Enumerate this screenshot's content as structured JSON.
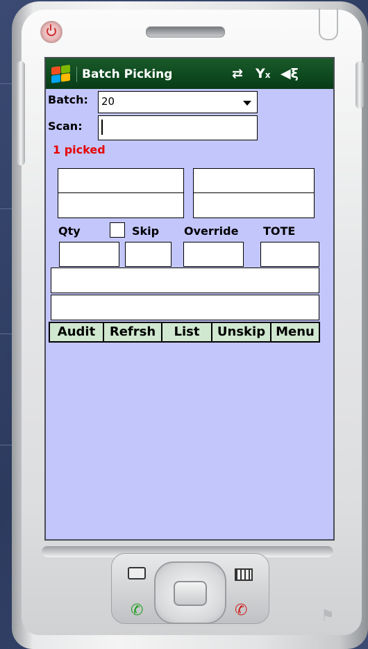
{
  "title": "Batch Picking",
  "icons": {
    "start": "windows-flag-icon",
    "connectivity": "sync-arrows-icon",
    "signal": "no-signal-icon",
    "volume": "speaker-mute-icon",
    "power": "power-icon",
    "contacts": "contact-card-icon",
    "calendar": "calendar-icon",
    "call": "green-phone-icon",
    "end": "red-phone-icon"
  },
  "form": {
    "batch_label": "Batch:",
    "batch_value": "20",
    "scan_label": "Scan:",
    "scan_value": "",
    "status": "1 picked",
    "qty_label": "Qty",
    "skip_label": "Skip",
    "override_label": "Override",
    "tote_label": "TOTE"
  },
  "toolbar": [
    "Audit",
    "Refrsh",
    "List",
    "Unskip",
    "Menu"
  ],
  "colors": {
    "screen_bg": "#c3c6fb",
    "titlebar": "#0e4a1f",
    "status_text": "#e60000",
    "button_bg": "#cfe8cf"
  }
}
